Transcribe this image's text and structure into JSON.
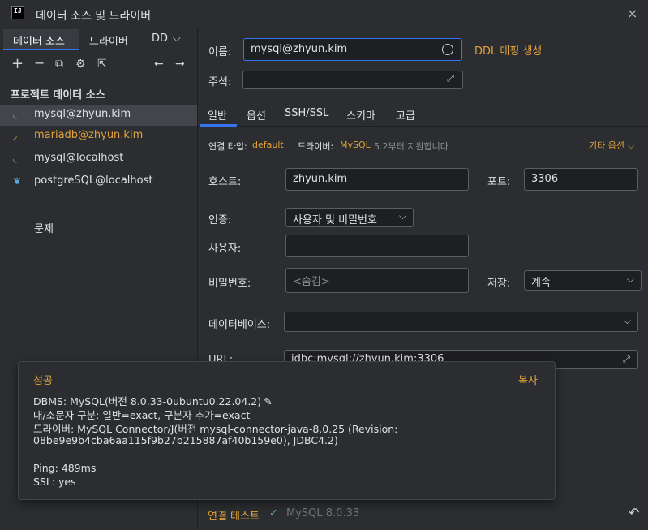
{
  "window": {
    "title": "데이터 소스 및 드라이버",
    "close_icon": "×"
  },
  "sidebar": {
    "tabs": [
      {
        "label": "데이터 소스",
        "selected": true
      },
      {
        "label": "드라이버"
      },
      {
        "label": "DD"
      }
    ],
    "toolbar": {
      "add": "+",
      "remove": "−",
      "copy": "⧉",
      "settings": "⚙",
      "export": "⇱",
      "back": "←",
      "forward": "→"
    },
    "section_title": "프로젝트 데이터 소스",
    "items": [
      {
        "label": "mysql@zhyun.kim",
        "selected": true,
        "color": "#dfe1e5",
        "icon": "dolphin-icon"
      },
      {
        "label": "mariadb@zhyun.kim",
        "color": "#e0a23c",
        "icon": "seal-icon"
      },
      {
        "label": "mysql@localhost",
        "color": "#dfe1e5",
        "icon": "dolphin-icon"
      },
      {
        "label": "postgreSQL@localhost",
        "color": "#dfe1e5",
        "icon": "elephant-icon"
      }
    ],
    "problems": "문제"
  },
  "main": {
    "name_label": "이름:",
    "name_value": "mysql@zhyun.kim",
    "ddl_link": "DDL 매핑 생성",
    "comment_label": "주석:",
    "tabs": [
      {
        "label": "일반",
        "selected": true
      },
      {
        "label": "옵션"
      },
      {
        "label": "SSH/SSL"
      },
      {
        "label": "스키마"
      },
      {
        "label": "고급"
      }
    ],
    "connection_type_label": "연결 타입:",
    "connection_type_value": "default",
    "driver_label": "드라이버:",
    "driver_value": "MySQL",
    "driver_note": "5.2부터 지원합니다",
    "more_options": "기타 옵션",
    "host_label": "호스트:",
    "host_value": "zhyun.kim",
    "port_label": "포트:",
    "port_value": "3306",
    "auth_label": "인증:",
    "auth_value": "사용자 및 비밀번호",
    "user_label": "사용자:",
    "user_value": "",
    "password_label": "비밀번호:",
    "password_placeholder": "<숨김>",
    "save_label": "저장:",
    "save_value": "계속",
    "database_label": "데이터베이스:",
    "database_value": "",
    "url_label": "URL:",
    "url_value": "jdbc:mysql://zhyun.kim:3306"
  },
  "popup": {
    "status": "성공",
    "copy": "복사",
    "lines": [
      "DBMS: MySQL(버전 8.0.33-0ubuntu0.22.04.2)",
      "대/소문자 구분: 일반=exact, 구분자 추가=exact",
      "드라이버: MySQL Connector/J(버전 mysql-connector-java-8.0.25 (Revision:",
      "08be9e9b4cba6aa115f9b27b215887af40b159e0), JDBC4.2)",
      "Ping: 489ms",
      "SSL: yes"
    ],
    "colors": {
      "status": "#e0a23c",
      "copy": "#e0a23c"
    }
  },
  "footer": {
    "test_connection": "연결 테스트",
    "check": "✓",
    "result": "MySQL 8.0.33",
    "revert": "↶"
  }
}
